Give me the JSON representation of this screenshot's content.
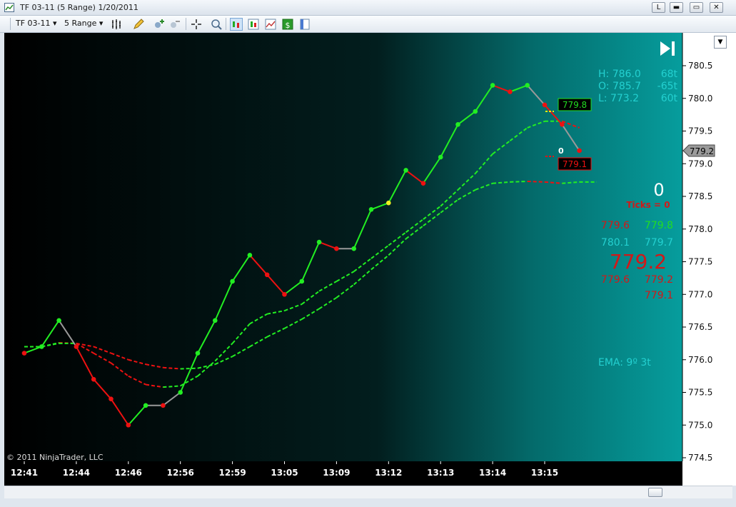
{
  "window": {
    "title": "TF 03-11 (5 Range)  1/20/2011",
    "buttons": {
      "restore_label": "L",
      "minimize_label": "▬",
      "maximize_label": "▭",
      "close_label": "✕"
    }
  },
  "toolbar": {
    "instrument": "TF 03-11",
    "interval": "5 Range"
  },
  "chart_data": {
    "type": "line",
    "copyright": "© 2011 NinjaTrader, LLC",
    "ylim": [
      774.3,
      780.8
    ],
    "yticks": [
      "774.5",
      "775.0",
      "775.5",
      "776.0",
      "776.5",
      "777.0",
      "777.5",
      "778.0",
      "778.5",
      "779.0",
      "779.5",
      "780.0",
      "780.5"
    ],
    "xticks": [
      "12:41",
      "12:44",
      "12:46",
      "12:56",
      "12:59",
      "13:05",
      "13:09",
      "13:12",
      "13:13",
      "13:14",
      "13:15"
    ],
    "xtick_bar_index": [
      0,
      3,
      6,
      9,
      12,
      15,
      18,
      21,
      24,
      27,
      30
    ],
    "series": [
      {
        "closes": [
          776.1,
          776.2,
          776.6,
          776.2,
          775.7,
          775.4,
          775.0,
          775.3,
          775.3,
          775.5,
          776.1,
          776.6,
          777.2,
          777.6,
          777.3,
          777.0,
          777.2,
          777.8,
          777.7,
          777.7,
          778.3,
          778.4,
          778.9,
          778.7,
          779.1,
          779.6,
          779.8,
          780.2,
          780.1,
          780.2,
          779.9,
          779.6,
          779.2
        ],
        "dot_colors": [
          "red",
          "green",
          "green",
          "red",
          "red",
          "red",
          "red",
          "green",
          "red",
          "green",
          "green",
          "green",
          "green",
          "green",
          "red",
          "red",
          "green",
          "green",
          "red",
          "green",
          "green",
          "yellow",
          "green",
          "red",
          "green",
          "green",
          "green",
          "green",
          "red",
          "green",
          "red",
          "red",
          "red"
        ]
      },
      {
        "values": [
          776.2,
          776.2,
          776.26,
          776.25,
          776.2,
          776.1,
          776.0,
          775.93,
          775.88,
          775.86,
          775.87,
          775.93,
          776.05,
          776.2,
          776.35,
          776.48,
          776.62,
          776.78,
          776.95,
          777.15,
          777.38,
          777.6,
          777.85,
          778.05,
          778.25,
          778.45,
          778.6,
          778.7,
          778.72,
          778.73,
          778.72,
          778.7,
          778.72,
          778.72
        ]
      },
      {
        "values": [
          776.2,
          776.2,
          776.25,
          776.25,
          776.1,
          775.95,
          775.75,
          775.62,
          775.58,
          775.6,
          775.75,
          775.98,
          776.25,
          776.55,
          776.7,
          776.75,
          776.85,
          777.05,
          777.2,
          777.35,
          777.55,
          777.75,
          777.95,
          778.15,
          778.35,
          778.6,
          778.85,
          779.15,
          779.35,
          779.55,
          779.65,
          779.65,
          779.55
        ]
      }
    ],
    "current_price": "779.2",
    "bid_label": "779.8",
    "ask_label": "779.1",
    "bar_counter": "0",
    "ohl": [
      {
        "label": "H: 786.0",
        "ticks": "68t"
      },
      {
        "label": "O: 785.7",
        "ticks": "-65t"
      },
      {
        "label": "L: 773.2",
        "ticks": "60t"
      }
    ],
    "ticks_big": "0",
    "ticks_label": "Ticks = 0",
    "ladder": [
      {
        "left": "779.6",
        "left_color": "#d21818",
        "right": "779.8",
        "right_color": "#22dd22"
      },
      {
        "left": "780.1",
        "left_color": "#23d0d0",
        "right": "779.7",
        "right_color": "#23d0d0"
      }
    ],
    "ladder_big": "779.2",
    "ladder_lower": [
      {
        "left": "779.6",
        "right": "779.2"
      },
      {
        "left": "",
        "right": "779.1"
      }
    ],
    "ema_label": "EMA: 9º  3t",
    "colors": {
      "bull": "#22ee22",
      "bear": "#ee1111",
      "neutral": "#999999",
      "cyan": "#23d0d0",
      "red_text": "#d21818"
    }
  }
}
